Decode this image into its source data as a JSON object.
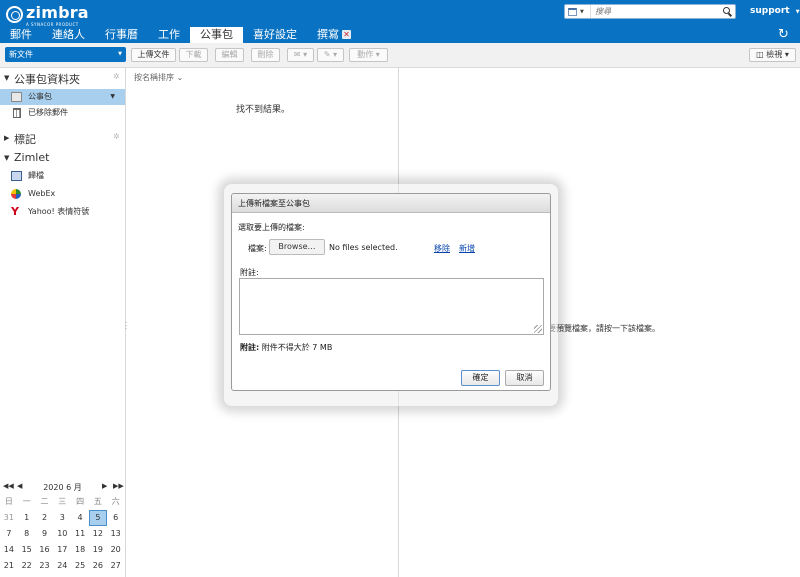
{
  "header": {
    "logo_text": "zimbra",
    "logo_sub": "A SYNACOR PRODUCT",
    "search_placeholder": "搜尋",
    "user": "support",
    "tabs": [
      {
        "label": "郵件"
      },
      {
        "label": "連絡人"
      },
      {
        "label": "行事曆"
      },
      {
        "label": "工作"
      },
      {
        "label": "公事包"
      },
      {
        "label": "喜好設定"
      },
      {
        "label": "撰寫"
      }
    ],
    "refresh_icon": "refresh-icon"
  },
  "toolbar": {
    "new_label": "新文件",
    "upload": "上傳文件",
    "download": "下載",
    "edit": "編輯",
    "delete": "刪除",
    "actions": "動作",
    "view": "檢視"
  },
  "sidebar": {
    "briefcase_header": "公事包資料夾",
    "items": [
      {
        "label": "公事包"
      },
      {
        "label": "已移除郵件"
      }
    ],
    "tags_header": "標記",
    "zimlet_header": "Zimlet",
    "zimlets": [
      {
        "label": "歸檔"
      },
      {
        "label": "WebEx"
      },
      {
        "label": "Yahoo! 表情符號"
      }
    ]
  },
  "calendar": {
    "title": "2020 6 月",
    "weekdays": [
      "日",
      "一",
      "二",
      "三",
      "四",
      "五",
      "六"
    ],
    "weeks": [
      [
        "31",
        "1",
        "2",
        "3",
        "4",
        "5",
        "6"
      ],
      [
        "7",
        "8",
        "9",
        "10",
        "11",
        "12",
        "13"
      ],
      [
        "14",
        "15",
        "16",
        "17",
        "18",
        "19",
        "20"
      ],
      [
        "21",
        "22",
        "23",
        "24",
        "25",
        "26",
        "27"
      ],
      [
        "28",
        "29",
        "30",
        "1",
        "2",
        "3",
        "4"
      ]
    ],
    "today": "5"
  },
  "list": {
    "sort_label": "按名稱排序",
    "empty_message": "找不到結果。"
  },
  "preview": {
    "hint": "要預覽檔案，請按一下該檔案。"
  },
  "dialog": {
    "title": "上傳新檔案至公事包",
    "select_label": "選取要上傳的檔案:",
    "file_label": "檔案:",
    "browse_label": "Browse…",
    "no_files": "No files selected.",
    "remove_link": "移除",
    "add_link": "新增",
    "notes_label": "附註:",
    "note_bold": "附註:",
    "note_text": " 附件不得大於 7 MB",
    "ok": "確定",
    "cancel": "取消"
  }
}
